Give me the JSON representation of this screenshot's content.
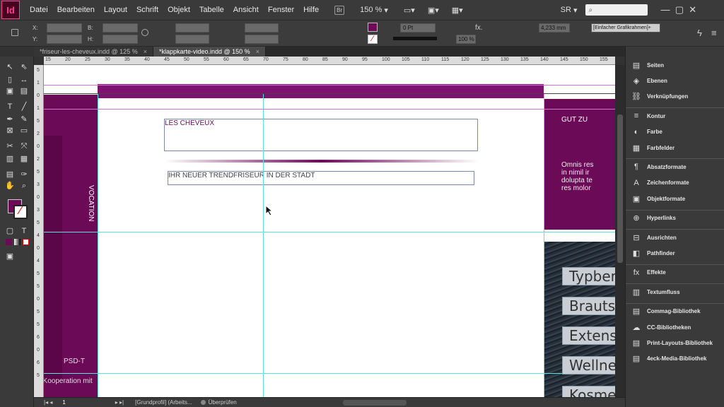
{
  "app": {
    "logo": "Id"
  },
  "menu": [
    "Datei",
    "Bearbeiten",
    "Layout",
    "Schrift",
    "Objekt",
    "Tabelle",
    "Ansicht",
    "Fenster",
    "Hilfe"
  ],
  "menubar": {
    "br_label": "Br",
    "zoom": "150 %",
    "workspace": "SR",
    "search_placeholder": ""
  },
  "controlbar": {
    "x_label": "X:",
    "y_label": "Y:",
    "w_label": "B:",
    "h_label": "H:",
    "stroke_weight": "0 Pt",
    "opacity": "100 %",
    "measure": "4,233 mm",
    "style": "[Einfacher Grafikrahmen]+"
  },
  "tabs": [
    {
      "label": "*friseur-les-cheveux.indd @ 125 %",
      "active": false
    },
    {
      "label": "*klappkarte-video.indd @ 150 %",
      "active": true
    }
  ],
  "ruler_h": [
    "15",
    "20",
    "25",
    "30",
    "35",
    "40",
    "45",
    "50",
    "55",
    "60",
    "65",
    "70",
    "75",
    "80",
    "85",
    "90",
    "95",
    "100",
    "105",
    "110",
    "115",
    "120",
    "125",
    "130",
    "135",
    "140",
    "145",
    "150",
    "155"
  ],
  "ruler_v": [
    "5",
    "1",
    "0",
    "1",
    "5",
    "2",
    "0",
    "2",
    "5",
    "3",
    "0",
    "3",
    "5",
    "4",
    "0",
    "4",
    "5",
    "5",
    "0",
    "5",
    "5",
    "6",
    "0",
    "6",
    "5"
  ],
  "document": {
    "title": "LES CHEVEUX",
    "subtitle": "IHR NEUER TRENDFRISEUR IN DER STADT",
    "vertical_text": "VOCATION",
    "right_heading": "GUT ZU",
    "right_body": [
      "Omnis res",
      "in nimil ir",
      "dolupta te",
      "res molor"
    ],
    "list": [
      "Typbera",
      "Brautst",
      "Extensio",
      "Wellnes",
      "Kosmet"
    ],
    "watermark": "PSD-T",
    "watermark_sub": "in Kooperation mit"
  },
  "panels": [
    {
      "icon": "pages-icon",
      "glyph": "▤",
      "label": "Seiten"
    },
    {
      "icon": "layers-icon",
      "glyph": "◈",
      "label": "Ebenen"
    },
    {
      "icon": "links-icon",
      "glyph": "⛓",
      "label": "Verknüpfungen"
    },
    {
      "icon": "stroke-icon",
      "glyph": "≡",
      "label": "Kontur"
    },
    {
      "icon": "color-icon",
      "glyph": "◐",
      "label": "Farbe"
    },
    {
      "icon": "swatches-icon",
      "glyph": "▦",
      "label": "Farbfelder"
    },
    {
      "icon": "paragraph-styles-icon",
      "glyph": "¶",
      "label": "Absatzformate"
    },
    {
      "icon": "character-styles-icon",
      "glyph": "A",
      "label": "Zeichenformate"
    },
    {
      "icon": "object-styles-icon",
      "glyph": "▣",
      "label": "Objektformate"
    },
    {
      "icon": "hyperlinks-icon",
      "glyph": "⊕",
      "label": "Hyperlinks"
    },
    {
      "icon": "align-icon",
      "glyph": "⊟",
      "label": "Ausrichten"
    },
    {
      "icon": "pathfinder-icon",
      "glyph": "◧",
      "label": "Pathfinder"
    },
    {
      "icon": "effects-icon",
      "glyph": "fx",
      "label": "Effekte"
    },
    {
      "icon": "text-wrap-icon",
      "glyph": "▥",
      "label": "Textumfluss"
    },
    {
      "icon": "commag-library-icon",
      "glyph": "▤",
      "label": "Commag-Bibliothek"
    },
    {
      "icon": "cc-libraries-icon",
      "glyph": "☁",
      "label": "CC-Bibliotheken"
    },
    {
      "icon": "print-layouts-icon",
      "glyph": "▤",
      "label": "Print-Layouts-Bibliothek"
    },
    {
      "icon": "media-library-icon",
      "glyph": "▤",
      "label": "4eck-Media-Bibliothek"
    }
  ],
  "status": {
    "page": "1",
    "profile": "[Grundprofil] (Arbeits...",
    "preflight": "Überprüfen"
  },
  "colors": {
    "accent": "#6b0a56",
    "band": "#7e1270",
    "guide_cyan": "#5ee0e0",
    "guide_magenta": "#d272d2"
  }
}
